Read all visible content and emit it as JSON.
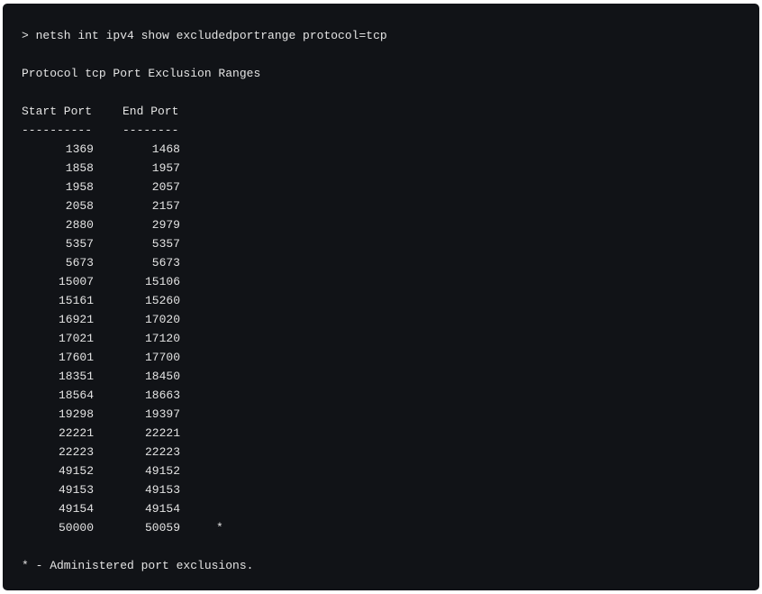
{
  "command": "> netsh int ipv4 show excludedportrange protocol=tcp",
  "title": "Protocol tcp Port Exclusion Ranges",
  "headers": {
    "start": "Start Port",
    "end": "End Port",
    "start_rule": "----------",
    "end_rule": "--------"
  },
  "rows": [
    {
      "start": "1369",
      "end": "1468",
      "mark": ""
    },
    {
      "start": "1858",
      "end": "1957",
      "mark": ""
    },
    {
      "start": "1958",
      "end": "2057",
      "mark": ""
    },
    {
      "start": "2058",
      "end": "2157",
      "mark": ""
    },
    {
      "start": "2880",
      "end": "2979",
      "mark": ""
    },
    {
      "start": "5357",
      "end": "5357",
      "mark": ""
    },
    {
      "start": "5673",
      "end": "5673",
      "mark": ""
    },
    {
      "start": "15007",
      "end": "15106",
      "mark": ""
    },
    {
      "start": "15161",
      "end": "15260",
      "mark": ""
    },
    {
      "start": "16921",
      "end": "17020",
      "mark": ""
    },
    {
      "start": "17021",
      "end": "17120",
      "mark": ""
    },
    {
      "start": "17601",
      "end": "17700",
      "mark": ""
    },
    {
      "start": "18351",
      "end": "18450",
      "mark": ""
    },
    {
      "start": "18564",
      "end": "18663",
      "mark": ""
    },
    {
      "start": "19298",
      "end": "19397",
      "mark": ""
    },
    {
      "start": "22221",
      "end": "22221",
      "mark": ""
    },
    {
      "start": "22223",
      "end": "22223",
      "mark": ""
    },
    {
      "start": "49152",
      "end": "49152",
      "mark": ""
    },
    {
      "start": "49153",
      "end": "49153",
      "mark": ""
    },
    {
      "start": "49154",
      "end": "49154",
      "mark": ""
    },
    {
      "start": "50000",
      "end": "50059",
      "mark": "*"
    }
  ],
  "footnote": "* - Administered port exclusions."
}
